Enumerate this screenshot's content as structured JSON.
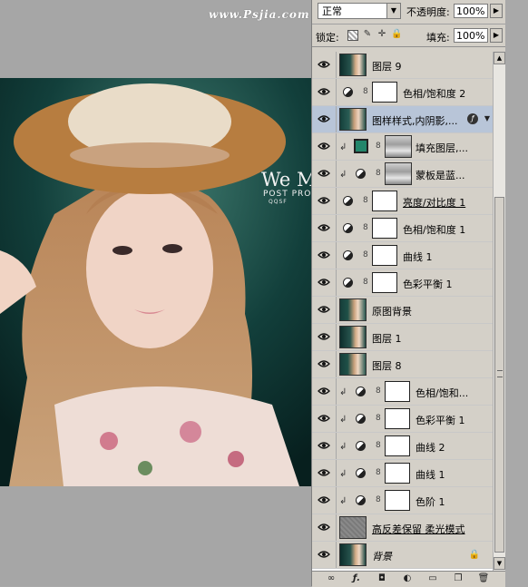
{
  "watermark": "www.Psjia.com",
  "photo": {
    "title": "We M",
    "subtitle": "POST PRO",
    "subtitle2": "QQSF"
  },
  "panel": {
    "blend_mode": "正常",
    "opacity_label": "不透明度:",
    "opacity_value": "100%",
    "lock_label": "锁定:",
    "fill_label": "填充:",
    "fill_value": "100%"
  },
  "layers": [
    {
      "name": "图层 9",
      "kind": "pixel"
    },
    {
      "name": "色相/饱和度 2",
      "kind": "adjust"
    },
    {
      "name": "图样样式,内阴影,...",
      "kind": "pixel",
      "selected": true,
      "fx": true
    },
    {
      "name": "填充图层,...",
      "kind": "fill",
      "clipped": true
    },
    {
      "name": "蒙板是蓝...",
      "kind": "adjust-mask",
      "clipped": true
    },
    {
      "name": "亮度/对比度 1",
      "kind": "adjust",
      "underline": true
    },
    {
      "name": "色相/饱和度 1",
      "kind": "adjust"
    },
    {
      "name": "曲线 1",
      "kind": "adjust"
    },
    {
      "name": "色彩平衡 1",
      "kind": "adjust"
    },
    {
      "name": "原图背景",
      "kind": "pixel"
    },
    {
      "name": "图层 1",
      "kind": "pixel"
    },
    {
      "name": "图层 8",
      "kind": "pixel"
    },
    {
      "name": "色相/饱和...",
      "kind": "adjust",
      "clipped": true
    },
    {
      "name": "色彩平衡 1",
      "kind": "adjust",
      "clipped": true
    },
    {
      "name": "曲线 2",
      "kind": "adjust",
      "clipped": true
    },
    {
      "name": "曲线 1",
      "kind": "adjust",
      "clipped": true
    },
    {
      "name": "色阶 1",
      "kind": "adjust",
      "clipped": true
    },
    {
      "name": "高反差保留 柔光模式",
      "kind": "gray",
      "underline": true
    },
    {
      "name": "背景",
      "kind": "pixel",
      "italic": true,
      "locked": true
    }
  ],
  "icons": {
    "eye": "eye-icon",
    "link": "link-icon",
    "fx": "fx-icon",
    "lock": "lock-icon"
  }
}
